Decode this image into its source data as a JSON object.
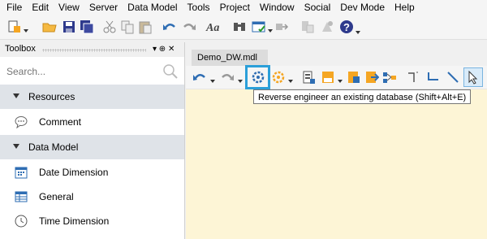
{
  "menu": [
    "File",
    "Edit",
    "View",
    "Server",
    "Data Model",
    "Tools",
    "Project",
    "Window",
    "Social",
    "Dev Mode",
    "Help"
  ],
  "toolbox": {
    "title": "Toolbox",
    "pin_symbol": "▾ ⊕ ✕",
    "search_placeholder": "Search...",
    "sections": [
      {
        "label": "Resources",
        "items": [
          "Comment"
        ]
      },
      {
        "label": "Data Model",
        "items": [
          "Date Dimension",
          "General",
          "Time Dimension"
        ]
      }
    ]
  },
  "document": {
    "tab_label": "Demo_DW.mdl",
    "tooltip": "Reverse engineer an existing database (Shift+Alt+E)"
  },
  "icons": {
    "main_toolbar": [
      "new-icon",
      "open-folder-icon",
      "save-icon",
      "save-all-icon",
      "cut-icon",
      "copy-icon",
      "paste-icon",
      "undo-icon",
      "redo-icon",
      "font-icon",
      "find-icon",
      "window-check-icon",
      "deploy-icon",
      "layout-icon",
      "plugin-icon",
      "help-icon"
    ],
    "doc_toolbar": [
      "undo-icon",
      "redo-icon",
      "reverse-engineer-icon",
      "generate-icon",
      "server-icon",
      "database-icon",
      "add-table-icon",
      "export-icon",
      "relationship-icon",
      "connector-icon",
      "line-icon",
      "pointer-icon"
    ]
  },
  "colors": {
    "accent": "#2b9fd9",
    "canvas": "#fdf5d6",
    "section_bg": "#dfe3e8",
    "icon_blue": "#2e6db3",
    "icon_orange": "#f5a623"
  }
}
